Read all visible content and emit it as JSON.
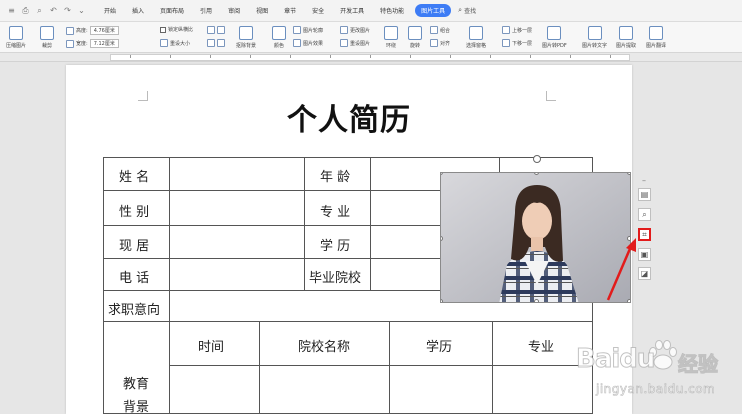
{
  "menu": {
    "quick_access": [
      "≡",
      "⎙",
      "⌕",
      "↶",
      "↷",
      "⌄"
    ],
    "tabs": [
      "开始",
      "插入",
      "页面布局",
      "引用",
      "审阅",
      "视图",
      "章节",
      "安全",
      "开发工具",
      "特色功能",
      "图片工具"
    ],
    "active_tab": "图片工具",
    "search_label": "查找"
  },
  "toolbar": {
    "compress_label": "压缩图片",
    "crop_label": "裁剪",
    "height_label": "高度:",
    "height_value": "4.76厘米",
    "width_label": "宽度:",
    "width_value": "7.12厘米",
    "lock_ratio_label": "锁定纵横比",
    "reset_size_label": "重设大小",
    "remove_bg_label": "抠除背景",
    "color_label": "颜色",
    "picture_outline_label": "图片轮廓",
    "picture_effects_label": "图片效果",
    "change_picture_label": "更改图片",
    "reset_picture_label": "重设图片",
    "wrap_label": "环绕",
    "rotate_label": "旋转",
    "combine_label": "组合",
    "align_label": "对齐",
    "select_pane_label": "选择窗格",
    "bring_forward_label": "上移一层",
    "send_backward_label": "下移一层",
    "to_pdf_label": "图片转PDF",
    "to_text_label": "图片转文字",
    "extract_label": "图片提取",
    "translate_label": "图片翻译"
  },
  "document": {
    "title": "个人简历",
    "rows": [
      {
        "left_label": "姓 名",
        "right_label": "年 龄"
      },
      {
        "left_label": "性 别",
        "right_label": "专 业"
      },
      {
        "left_label": "现 居",
        "right_label": "学 历"
      },
      {
        "left_label": "电 话",
        "right_label": "毕业院校"
      }
    ],
    "job_intention_label": "求职意向",
    "education": {
      "section_label_line1": "教育",
      "section_label_line2": "背景",
      "headers": [
        "时间",
        "院校名称",
        "学历",
        "专业"
      ]
    }
  },
  "watermark": {
    "brand": "Baidu",
    "brand_cn": "经验",
    "url": "jingyan.baidu.com"
  },
  "colors": {
    "accent": "#3d7cf5",
    "highlight_red": "#e21b1b"
  }
}
